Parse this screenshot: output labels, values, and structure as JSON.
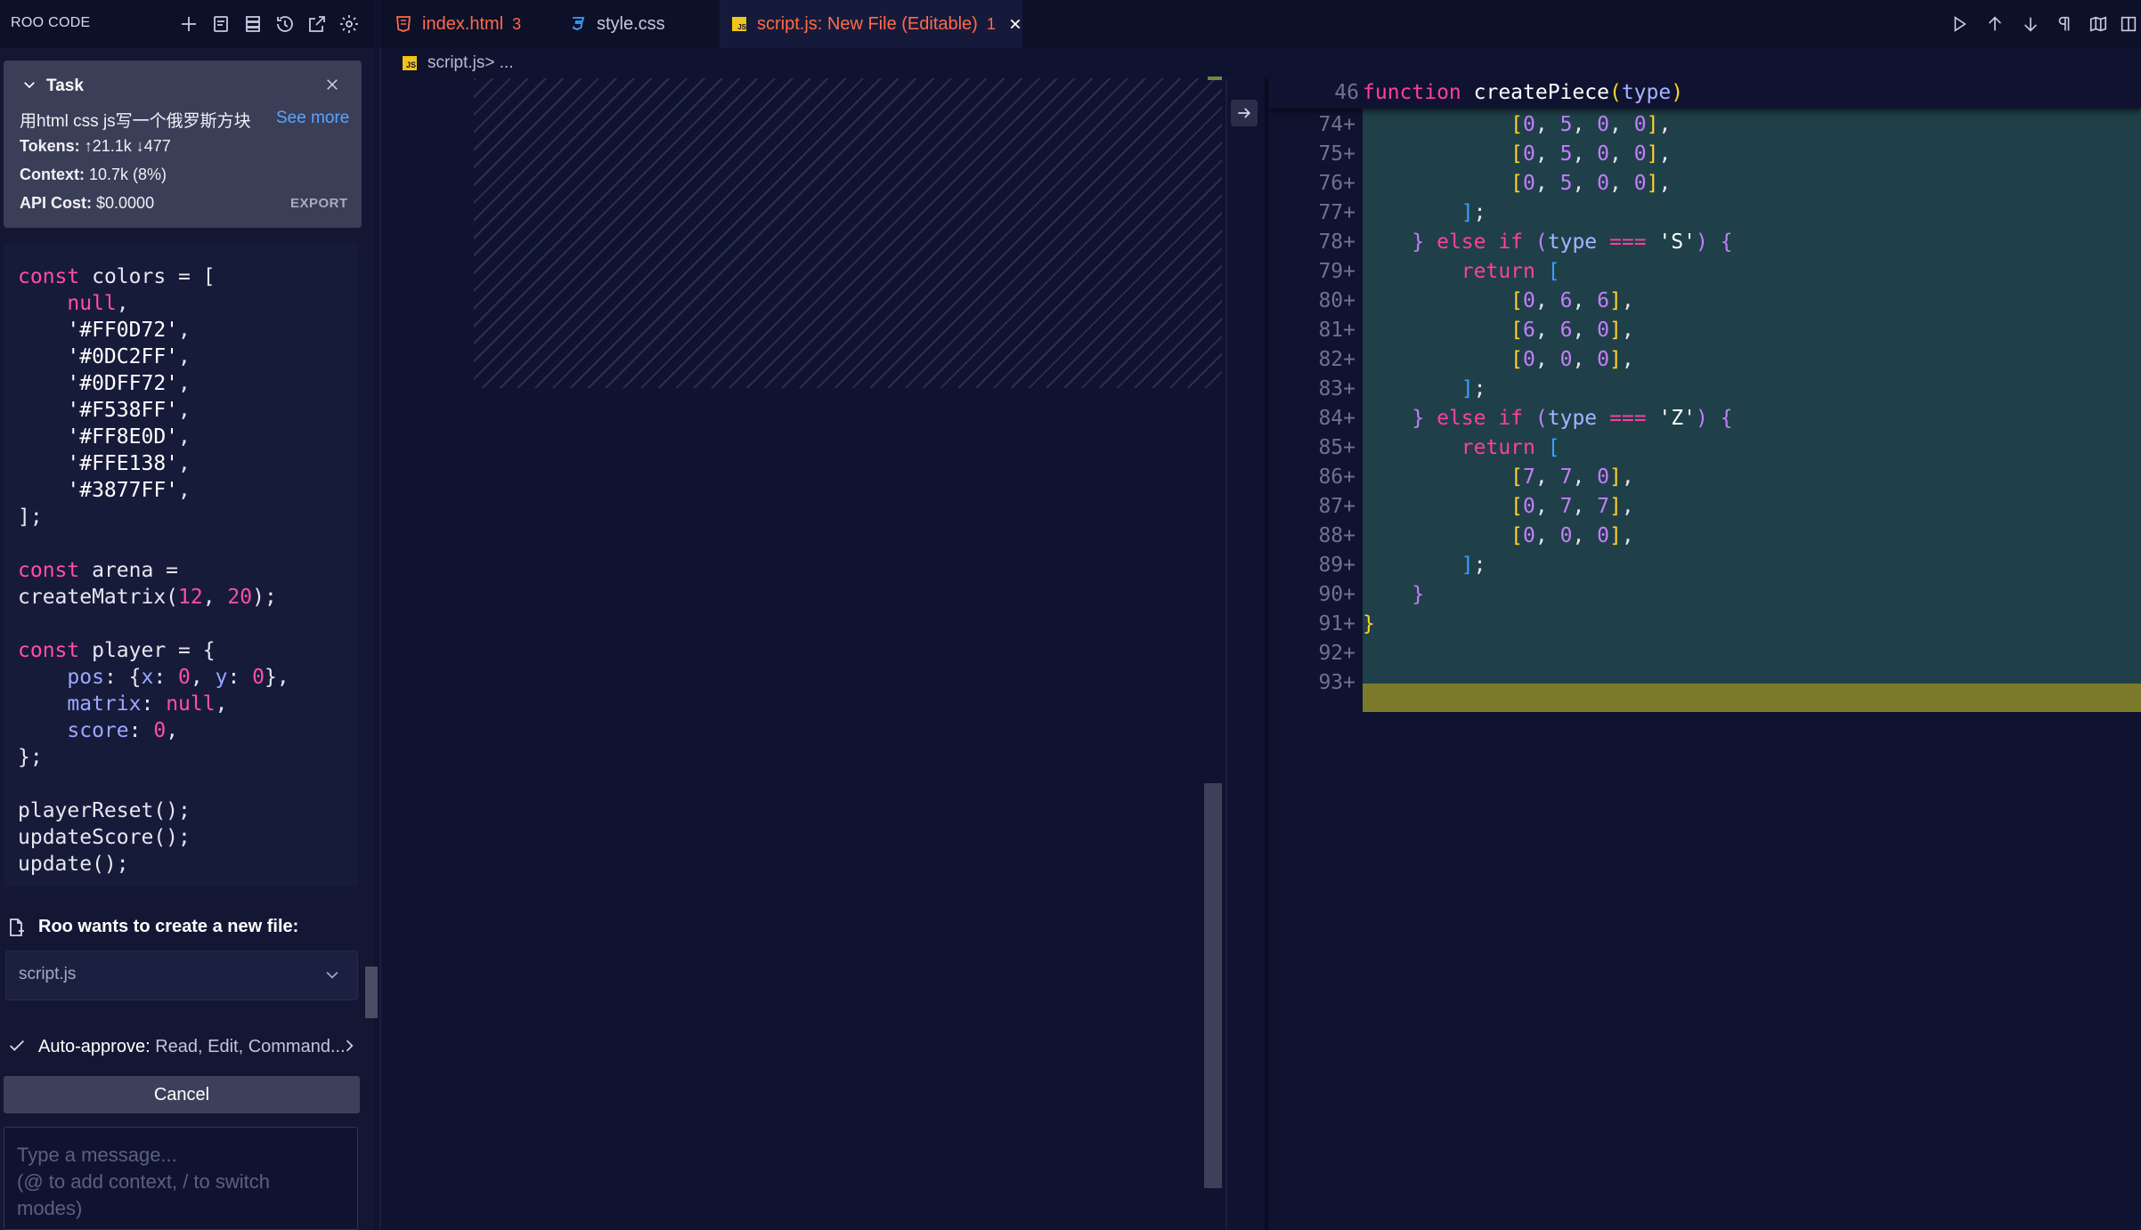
{
  "roo": {
    "title": "ROO CODE",
    "header_icons": [
      "plus-icon",
      "notes-icon",
      "database-icon",
      "history-icon",
      "popout-icon",
      "gear-icon"
    ]
  },
  "task": {
    "label": "Task",
    "text": "用html css js写一个俄罗斯方块",
    "see_more": "See more",
    "tokens_label": "Tokens:",
    "tokens_up": "21.1k",
    "tokens_down": "477",
    "context_label": "Context:",
    "context_value": "10.7k (8%)",
    "cost_label": "API Cost:",
    "cost_value": "$0.0000",
    "export": "EXPORT"
  },
  "left_code": {
    "lines": [
      [
        [
          "kw",
          "const"
        ],
        [
          "txt",
          " colors = ["
        ]
      ],
      [
        [
          "txt",
          "    "
        ],
        [
          "kw",
          "null"
        ],
        [
          "txt",
          ","
        ]
      ],
      [
        [
          "txt",
          "    "
        ],
        [
          "str",
          "'#FF0D72'"
        ],
        [
          "txt",
          ","
        ]
      ],
      [
        [
          "txt",
          "    "
        ],
        [
          "str",
          "'#0DC2FF'"
        ],
        [
          "txt",
          ","
        ]
      ],
      [
        [
          "txt",
          "    "
        ],
        [
          "str",
          "'#0DFF72'"
        ],
        [
          "txt",
          ","
        ]
      ],
      [
        [
          "txt",
          "    "
        ],
        [
          "str",
          "'#F538FF'"
        ],
        [
          "txt",
          ","
        ]
      ],
      [
        [
          "txt",
          "    "
        ],
        [
          "str",
          "'#FF8E0D'"
        ],
        [
          "txt",
          ","
        ]
      ],
      [
        [
          "txt",
          "    "
        ],
        [
          "str",
          "'#FFE138'"
        ],
        [
          "txt",
          ","
        ]
      ],
      [
        [
          "txt",
          "    "
        ],
        [
          "str",
          "'#3877FF'"
        ],
        [
          "txt",
          ","
        ]
      ],
      [
        [
          "txt",
          "];"
        ]
      ],
      [
        [
          "txt",
          ""
        ]
      ],
      [
        [
          "kw",
          "const"
        ],
        [
          "txt",
          " arena ="
        ]
      ],
      [
        [
          "txt",
          "createMatrix("
        ],
        [
          "num",
          "12"
        ],
        [
          "txt",
          ", "
        ],
        [
          "num",
          "20"
        ],
        [
          "txt",
          ");"
        ]
      ],
      [
        [
          "txt",
          ""
        ]
      ],
      [
        [
          "kw",
          "const"
        ],
        [
          "txt",
          " player = {"
        ]
      ],
      [
        [
          "txt",
          "    "
        ],
        [
          "prop",
          "pos"
        ],
        [
          "txt",
          ": {"
        ],
        [
          "prop",
          "x"
        ],
        [
          "txt",
          ": "
        ],
        [
          "num",
          "0"
        ],
        [
          "txt",
          ", "
        ],
        [
          "prop",
          "y"
        ],
        [
          "txt",
          ": "
        ],
        [
          "num",
          "0"
        ],
        [
          "txt",
          "},"
        ]
      ],
      [
        [
          "txt",
          "    "
        ],
        [
          "prop",
          "matrix"
        ],
        [
          "txt",
          ": "
        ],
        [
          "kw",
          "null"
        ],
        [
          "txt",
          ","
        ]
      ],
      [
        [
          "txt",
          "    "
        ],
        [
          "prop",
          "score"
        ],
        [
          "txt",
          ": "
        ],
        [
          "num",
          "0"
        ],
        [
          "txt",
          ","
        ]
      ],
      [
        [
          "txt",
          "};"
        ]
      ],
      [
        [
          "txt",
          ""
        ]
      ],
      [
        [
          "txt",
          "playerReset();"
        ]
      ],
      [
        [
          "txt",
          "updateScore();"
        ]
      ],
      [
        [
          "txt",
          "update();"
        ]
      ]
    ]
  },
  "approval": {
    "create_text": "Roo wants to create a new file:",
    "file_value": "script.js",
    "auto_label": "Auto-approve:",
    "auto_value": "Read, Edit, Command...",
    "cancel": "Cancel",
    "input_placeholder": "Type a message...\n(@ to add context, / to switch\nmodes)"
  },
  "tabs": [
    {
      "label": "index.html",
      "badge": "3",
      "color": "#ff6b4a",
      "icon": "html-file-icon"
    },
    {
      "label": "style.css",
      "badge": "",
      "color": "#c7c8d8",
      "icon": "css-file-icon"
    },
    {
      "label": "script.js: New File (Editable)",
      "badge": "1",
      "color": "#ff6b4a",
      "icon": "js-file-icon"
    }
  ],
  "breadcrumb": {
    "file": "script.js",
    "rest": " > ..."
  },
  "diff": {
    "sticky": {
      "num": "46",
      "line": [
        [
          "c-pink",
          "function"
        ],
        [
          "c-white",
          " createPiece"
        ],
        [
          "c-yellow",
          "("
        ],
        [
          "c-lav",
          "type"
        ],
        [
          "c-yellow",
          ")"
        ]
      ]
    },
    "lines": [
      {
        "num": "74+",
        "tokens": [
          [
            "txt",
            "            "
          ],
          [
            "c-yellow",
            "["
          ],
          [
            "c-purple",
            "0"
          ],
          [
            "txt",
            ", "
          ],
          [
            "c-purple",
            "5"
          ],
          [
            "txt",
            ", "
          ],
          [
            "c-purple",
            "0"
          ],
          [
            "txt",
            ", "
          ],
          [
            "c-purple",
            "0"
          ],
          [
            "c-yellow",
            "]"
          ],
          [
            "txt",
            ","
          ]
        ]
      },
      {
        "num": "75+",
        "tokens": [
          [
            "txt",
            "            "
          ],
          [
            "c-yellow",
            "["
          ],
          [
            "c-purple",
            "0"
          ],
          [
            "txt",
            ", "
          ],
          [
            "c-purple",
            "5"
          ],
          [
            "txt",
            ", "
          ],
          [
            "c-purple",
            "0"
          ],
          [
            "txt",
            ", "
          ],
          [
            "c-purple",
            "0"
          ],
          [
            "c-yellow",
            "]"
          ],
          [
            "txt",
            ","
          ]
        ]
      },
      {
        "num": "76+",
        "tokens": [
          [
            "txt",
            "            "
          ],
          [
            "c-yellow",
            "["
          ],
          [
            "c-purple",
            "0"
          ],
          [
            "txt",
            ", "
          ],
          [
            "c-purple",
            "5"
          ],
          [
            "txt",
            ", "
          ],
          [
            "c-purple",
            "0"
          ],
          [
            "txt",
            ", "
          ],
          [
            "c-purple",
            "0"
          ],
          [
            "c-yellow",
            "]"
          ],
          [
            "txt",
            ","
          ]
        ]
      },
      {
        "num": "77+",
        "tokens": [
          [
            "txt",
            "        "
          ],
          [
            "c-blue",
            "]"
          ],
          [
            "txt",
            ";"
          ]
        ]
      },
      {
        "num": "78+",
        "tokens": [
          [
            "txt",
            "    "
          ],
          [
            "c-purple",
            "}"
          ],
          [
            "c-pink",
            " else if"
          ],
          [
            "txt",
            " "
          ],
          [
            "c-purple",
            "("
          ],
          [
            "c-lav",
            "type"
          ],
          [
            "txt",
            " "
          ],
          [
            "c-pink",
            "==="
          ],
          [
            "txt",
            " "
          ],
          [
            "c-white",
            "'S'"
          ],
          [
            "c-purple",
            ")"
          ],
          [
            "txt",
            " "
          ],
          [
            "c-purple",
            "{"
          ]
        ]
      },
      {
        "num": "79+",
        "tokens": [
          [
            "txt",
            "        "
          ],
          [
            "c-pink",
            "return"
          ],
          [
            "txt",
            " "
          ],
          [
            "c-blue",
            "["
          ]
        ]
      },
      {
        "num": "80+",
        "tokens": [
          [
            "txt",
            "            "
          ],
          [
            "c-yellow",
            "["
          ],
          [
            "c-purple",
            "0"
          ],
          [
            "txt",
            ", "
          ],
          [
            "c-purple",
            "6"
          ],
          [
            "txt",
            ", "
          ],
          [
            "c-purple",
            "6"
          ],
          [
            "c-yellow",
            "]"
          ],
          [
            "txt",
            ","
          ]
        ]
      },
      {
        "num": "81+",
        "tokens": [
          [
            "txt",
            "            "
          ],
          [
            "c-yellow",
            "["
          ],
          [
            "c-purple",
            "6"
          ],
          [
            "txt",
            ", "
          ],
          [
            "c-purple",
            "6"
          ],
          [
            "txt",
            ", "
          ],
          [
            "c-purple",
            "0"
          ],
          [
            "c-yellow",
            "]"
          ],
          [
            "txt",
            ","
          ]
        ]
      },
      {
        "num": "82+",
        "tokens": [
          [
            "txt",
            "            "
          ],
          [
            "c-yellow",
            "["
          ],
          [
            "c-purple",
            "0"
          ],
          [
            "txt",
            ", "
          ],
          [
            "c-purple",
            "0"
          ],
          [
            "txt",
            ", "
          ],
          [
            "c-purple",
            "0"
          ],
          [
            "c-yellow",
            "]"
          ],
          [
            "txt",
            ","
          ]
        ]
      },
      {
        "num": "83+",
        "tokens": [
          [
            "txt",
            "        "
          ],
          [
            "c-blue",
            "]"
          ],
          [
            "txt",
            ";"
          ]
        ]
      },
      {
        "num": "84+",
        "tokens": [
          [
            "txt",
            "    "
          ],
          [
            "c-purple",
            "}"
          ],
          [
            "c-pink",
            " else if"
          ],
          [
            "txt",
            " "
          ],
          [
            "c-purple",
            "("
          ],
          [
            "c-lav",
            "type"
          ],
          [
            "txt",
            " "
          ],
          [
            "c-pink",
            "==="
          ],
          [
            "txt",
            " "
          ],
          [
            "c-white",
            "'Z'"
          ],
          [
            "c-purple",
            ")"
          ],
          [
            "txt",
            " "
          ],
          [
            "c-purple",
            "{"
          ]
        ]
      },
      {
        "num": "85+",
        "tokens": [
          [
            "txt",
            "        "
          ],
          [
            "c-pink",
            "return"
          ],
          [
            "txt",
            " "
          ],
          [
            "c-blue",
            "["
          ]
        ]
      },
      {
        "num": "86+",
        "tokens": [
          [
            "txt",
            "            "
          ],
          [
            "c-yellow",
            "["
          ],
          [
            "c-purple",
            "7"
          ],
          [
            "txt",
            ", "
          ],
          [
            "c-purple",
            "7"
          ],
          [
            "txt",
            ", "
          ],
          [
            "c-purple",
            "0"
          ],
          [
            "c-yellow",
            "]"
          ],
          [
            "txt",
            ","
          ]
        ]
      },
      {
        "num": "87+",
        "tokens": [
          [
            "txt",
            "            "
          ],
          [
            "c-yellow",
            "["
          ],
          [
            "c-purple",
            "0"
          ],
          [
            "txt",
            ", "
          ],
          [
            "c-purple",
            "7"
          ],
          [
            "txt",
            ", "
          ],
          [
            "c-purple",
            "7"
          ],
          [
            "c-yellow",
            "]"
          ],
          [
            "txt",
            ","
          ]
        ]
      },
      {
        "num": "88+",
        "tokens": [
          [
            "txt",
            "            "
          ],
          [
            "c-yellow",
            "["
          ],
          [
            "c-purple",
            "0"
          ],
          [
            "txt",
            ", "
          ],
          [
            "c-purple",
            "0"
          ],
          [
            "txt",
            ", "
          ],
          [
            "c-purple",
            "0"
          ],
          [
            "c-yellow",
            "]"
          ],
          [
            "txt",
            ","
          ]
        ]
      },
      {
        "num": "89+",
        "tokens": [
          [
            "txt",
            "        "
          ],
          [
            "c-blue",
            "]"
          ],
          [
            "txt",
            ";"
          ]
        ]
      },
      {
        "num": "90+",
        "tokens": [
          [
            "txt",
            "    "
          ],
          [
            "c-purple",
            "}"
          ]
        ]
      },
      {
        "num": "91+",
        "tokens": [
          [
            "c-yellow",
            "}"
          ]
        ]
      },
      {
        "num": "92+",
        "tokens": [
          [
            "txt",
            ""
          ]
        ]
      },
      {
        "num": "93+",
        "tokens": [
          [
            "txt",
            ""
          ]
        ]
      }
    ]
  },
  "colors": {
    "accent_pink": "#ff3fa0",
    "accent_yellow": "#ffd22a",
    "accent_purple": "#c77dff",
    "accent_blue": "#3aa0ff",
    "added_bg": "#1f4049",
    "current_line": "#7a7a2a",
    "bg": "#0f1330"
  }
}
